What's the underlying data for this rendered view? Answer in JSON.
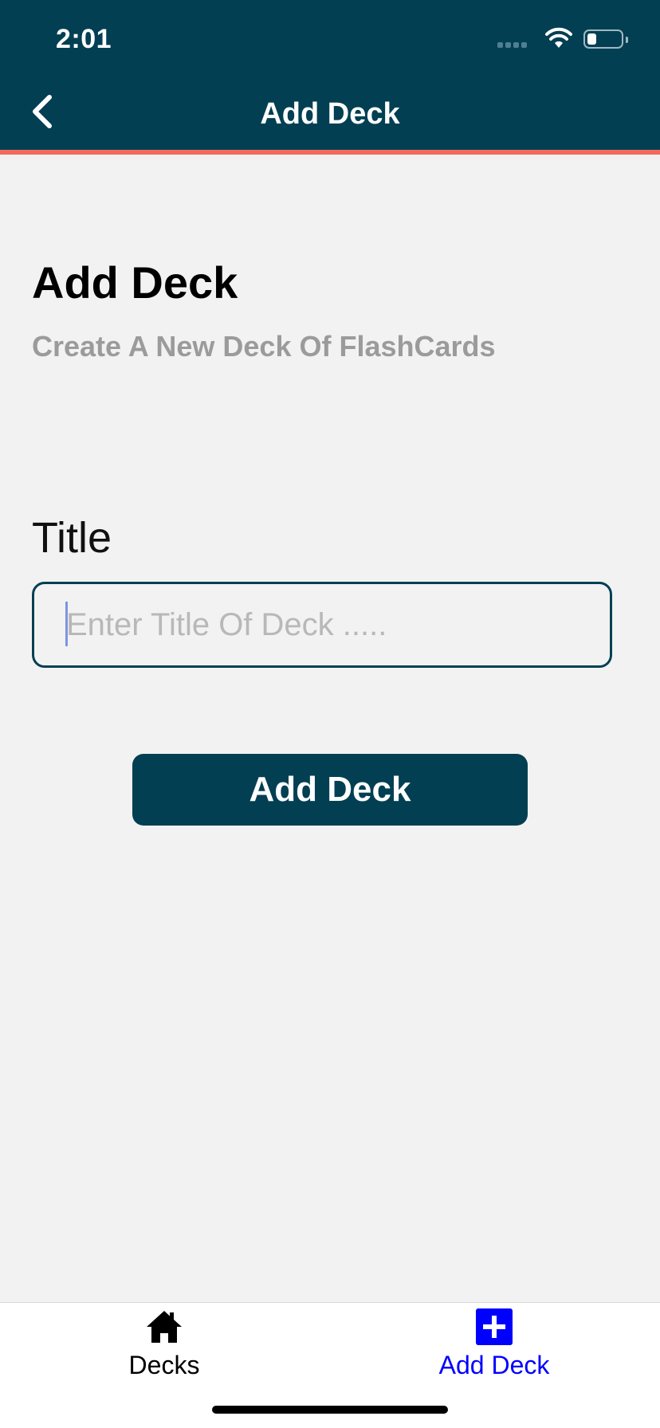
{
  "status_bar": {
    "time": "2:01"
  },
  "header": {
    "title": "Add Deck",
    "back_icon": "chevron-left-icon",
    "background_color": "#023f53",
    "accent_color": "#f26b5b"
  },
  "main": {
    "heading": "Add Deck",
    "subheading": "Create A New Deck Of FlashCards",
    "title_label": "Title",
    "title_input": {
      "value": "",
      "placeholder": "Enter Title Of Deck ....."
    },
    "submit_label": "Add Deck"
  },
  "tabbar": {
    "tabs": [
      {
        "label": "Decks",
        "icon": "home-icon",
        "active": false,
        "color": "#000000"
      },
      {
        "label": "Add Deck",
        "icon": "plus-square-icon",
        "active": true,
        "color": "#0000ff"
      }
    ]
  }
}
